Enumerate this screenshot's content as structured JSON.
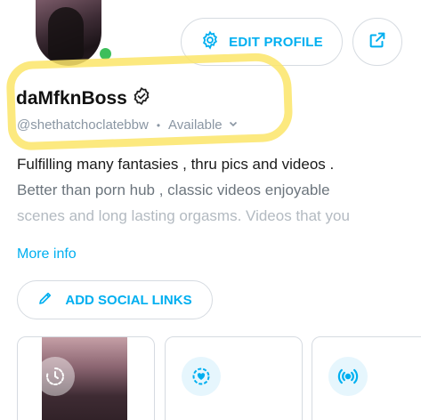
{
  "profile": {
    "display_name": "daMfknBoss",
    "username": "@shethatchoclatebbw",
    "separator": "•",
    "status": "Available",
    "online": true,
    "verified": true
  },
  "header": {
    "edit_profile_label": "EDIT PROFILE"
  },
  "bio": {
    "line1": "Fulfilling many fantasies , thru pics and videos .",
    "line2": "Better than porn hub , classic videos enjoyable",
    "line3": "scenes and long lasting orgasms. Videos that you"
  },
  "more_info_label": "More info",
  "social": {
    "add_label": "ADD SOCIAL LINKS"
  },
  "colors": {
    "accent": "#00aff0",
    "online": "#3dbe5b",
    "highlight": "#fce569",
    "muted": "#8a96a3"
  },
  "icons": {
    "edit": "gear-icon",
    "share": "share-icon",
    "verified": "verified-badge-icon",
    "pencil": "pencil-icon",
    "timer": "timer-icon",
    "heart": "heart-icon",
    "live": "broadcast-icon"
  }
}
